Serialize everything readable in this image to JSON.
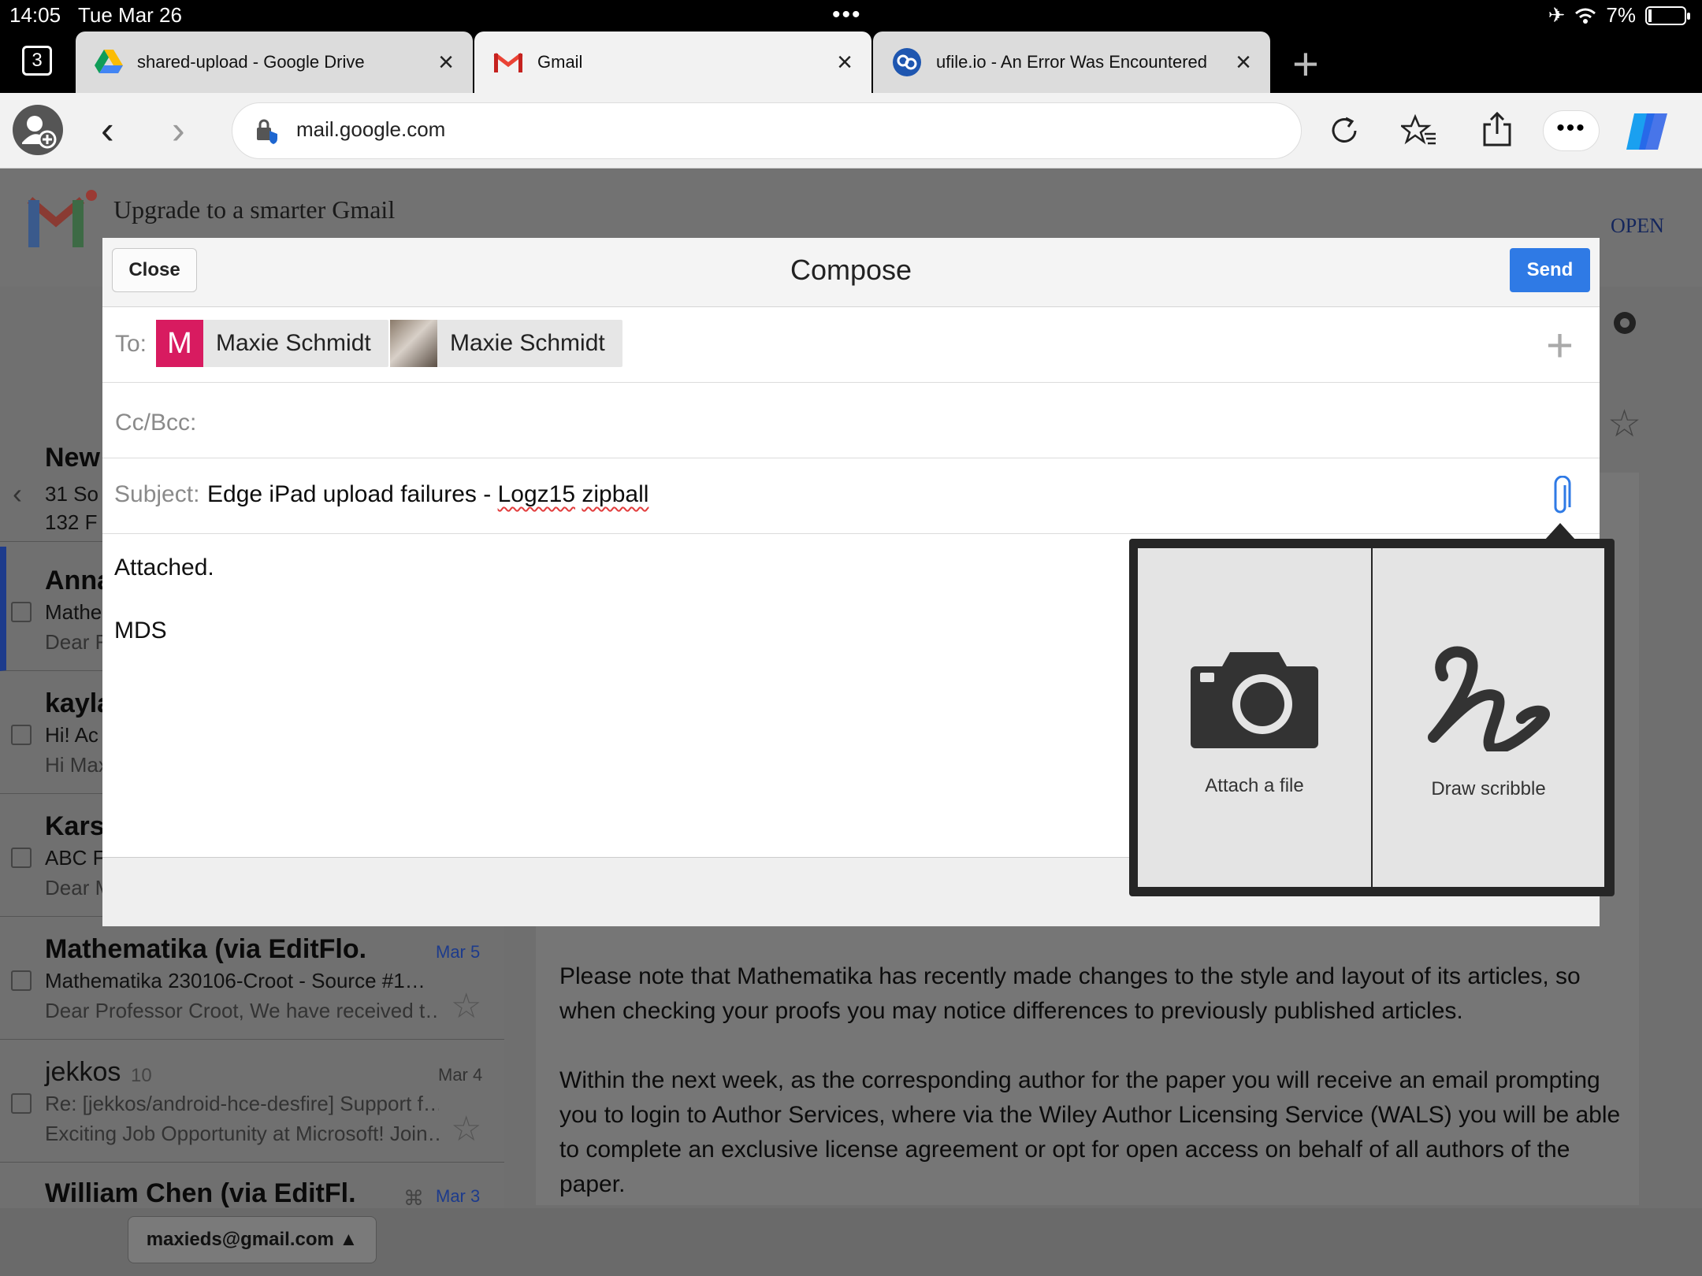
{
  "status": {
    "time": "14:05",
    "date": "Tue Mar 26",
    "battery": "7%"
  },
  "tabs": {
    "count": "3",
    "items": [
      {
        "title": "shared-upload - Google Drive"
      },
      {
        "title": "Gmail"
      },
      {
        "title": "ufile.io - An Error Was Encountered"
      }
    ]
  },
  "address": {
    "url": "mail.google.com"
  },
  "gmail": {
    "banner": "Upgrade to a smarter Gmail",
    "open": "OPEN",
    "list": [
      {
        "name": "New",
        "sub": "31 So",
        "prev": "132 F"
      },
      {
        "name": "Anna",
        "sub": "Mathe",
        "prev": "Dear F"
      },
      {
        "name": "kayla",
        "sub": "Hi! Ac",
        "prev": "Hi Max"
      },
      {
        "name": "Kars",
        "sub": "ABC F",
        "prev": "Dear M"
      },
      {
        "name": "Mathematika (via EditFlo.",
        "date": "Mar 5",
        "sub": "Mathematika 230106-Croot - Source #1…",
        "prev": "Dear Professor Croot, We have received t…"
      },
      {
        "name": "jekkos",
        "count": "10",
        "date": "Mar 4",
        "sub": "Re: [jekkos/android-hce-desfire] Support f…",
        "prev": "Exciting Job Opportunity at Microsoft! Join…"
      },
      {
        "name": "William Chen (via EditFl.",
        "date": "Mar 3"
      }
    ],
    "body": [
      "Please note that Mathematika has recently made changes to the style and layout of its articles, so when checking your proofs you may notice differences to previously published articles.",
      "Within the next week, as the corresponding author for the paper you will receive an email prompting you to login to Author Services, where via the Wiley Author Licensing Service (WALS) you will be able to complete an exclusive license agreement or opt for open access on behalf of all authors of the paper."
    ],
    "account": "maxieds@gmail.com"
  },
  "compose": {
    "close": "Close",
    "title": "Compose",
    "send": "Send",
    "to_label": "To:",
    "recipients": [
      {
        "initial": "M",
        "name": "Maxie Schmidt"
      },
      {
        "name": "Maxie Schmidt"
      }
    ],
    "cc_label": "Cc/Bcc:",
    "subject_label": "Subject:",
    "subject_a": "Edge iPad upload failures - ",
    "subject_b": "Logz15",
    "subject_c": " ",
    "subject_d": "zipball",
    "body_line1": "Attached.",
    "body_line2": "MDS"
  },
  "popover": {
    "attach": "Attach a file",
    "scribble": "Draw scribble"
  },
  "colors": {
    "accent": "#2f7ae5",
    "chip_m": "#d81b60"
  }
}
